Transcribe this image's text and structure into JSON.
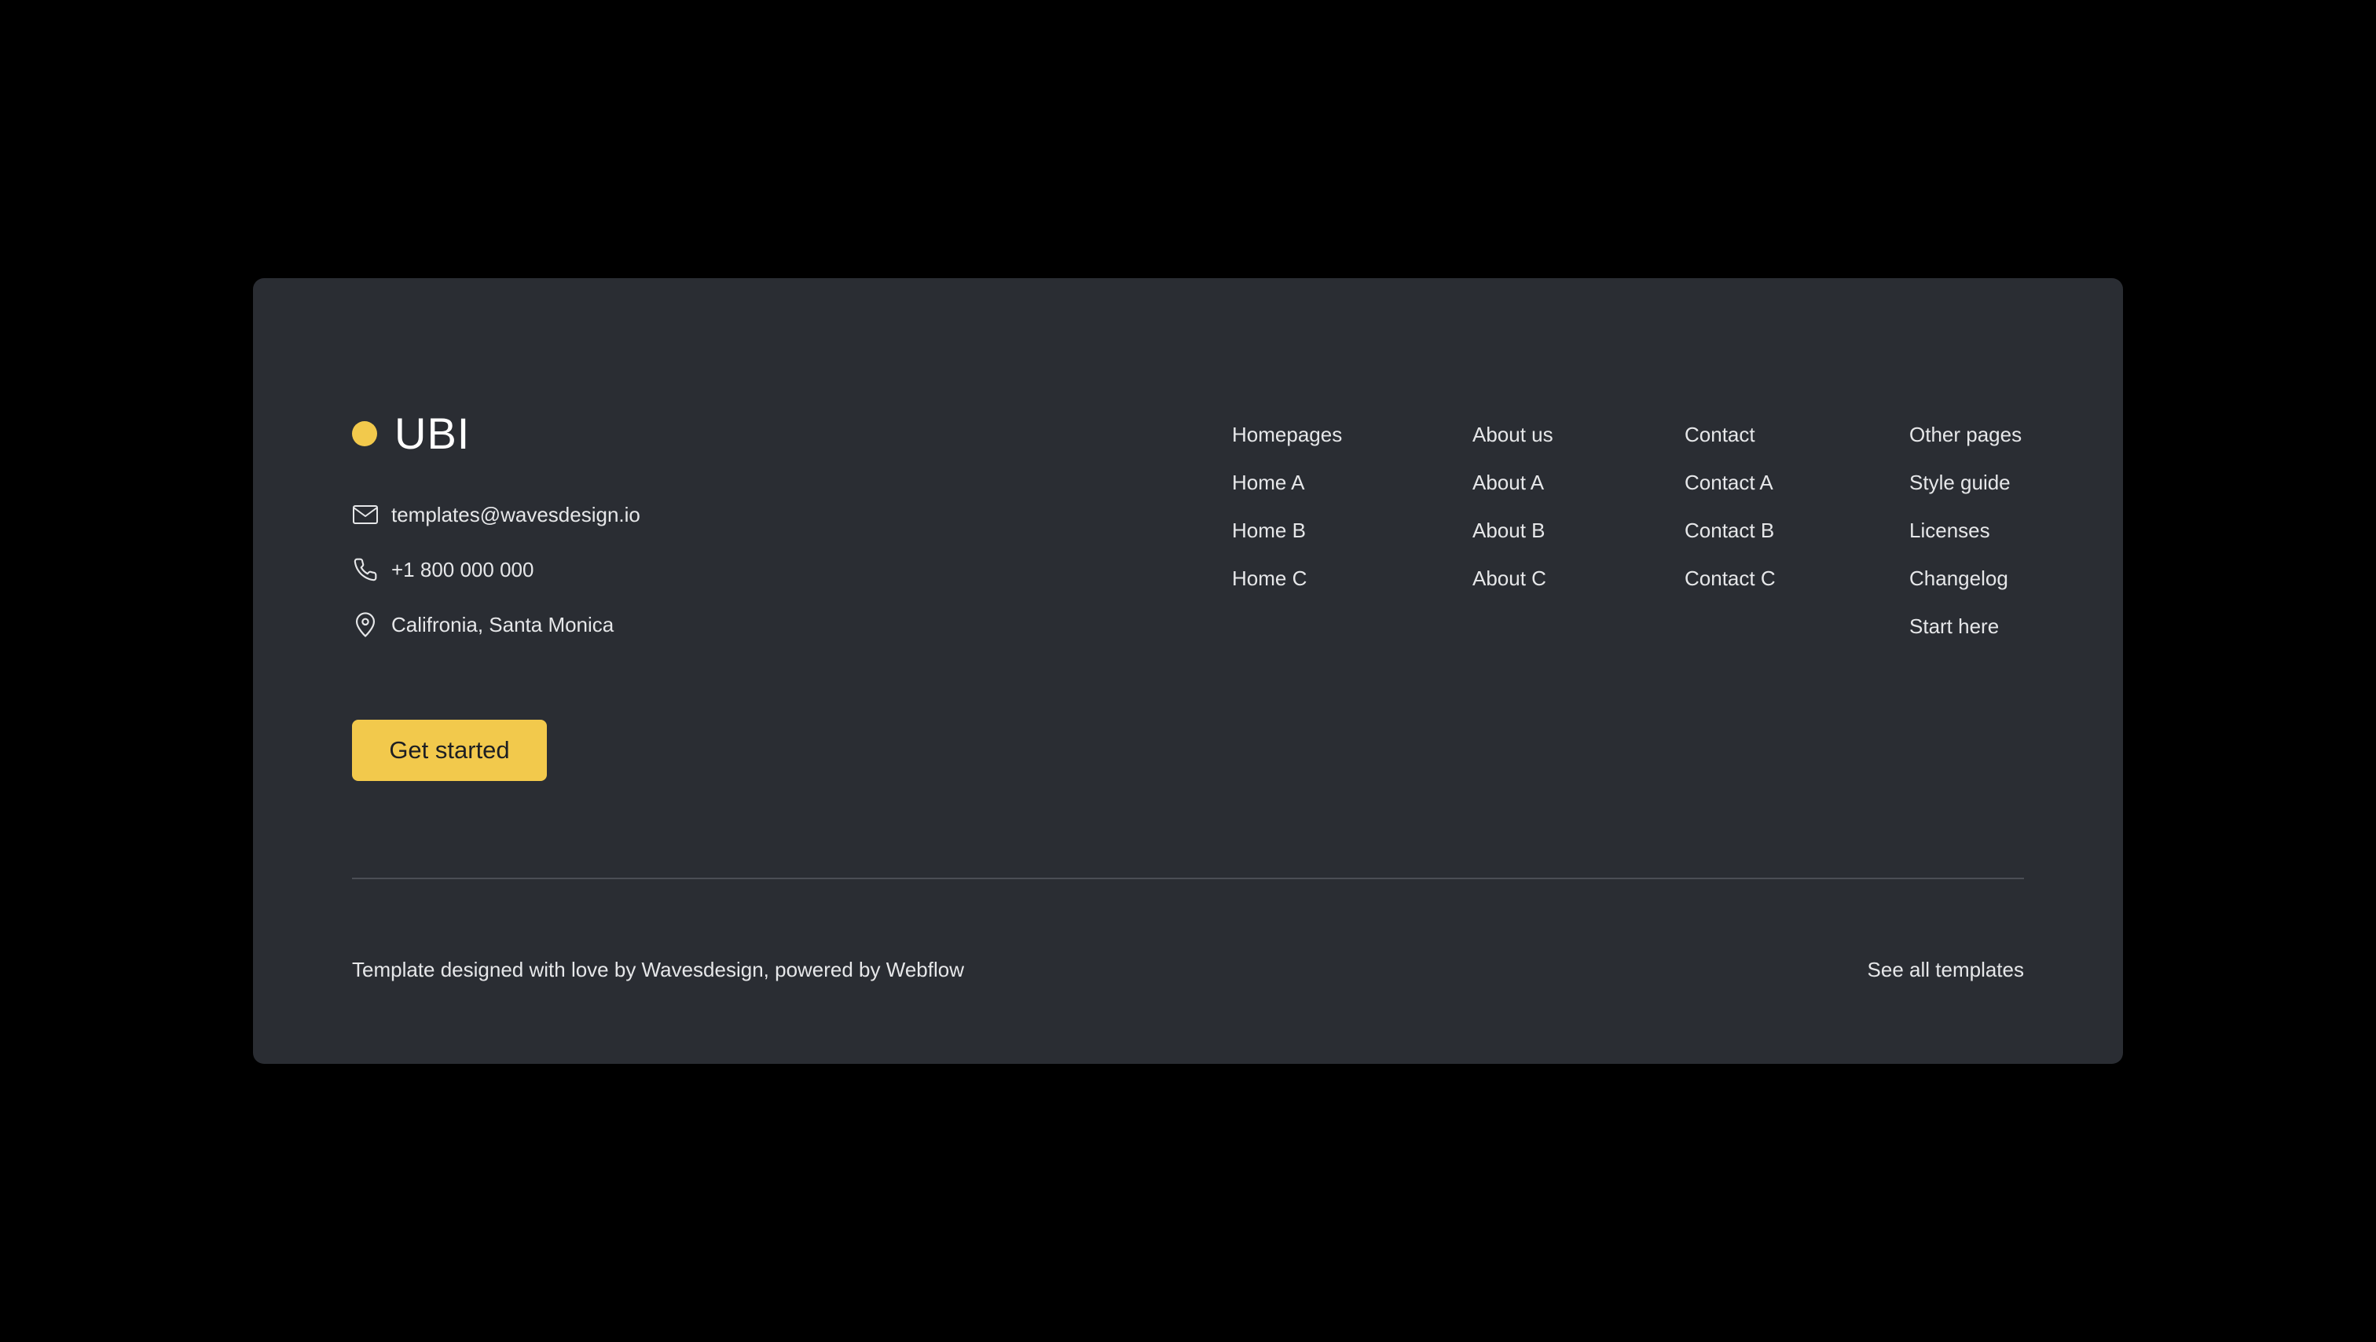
{
  "brand": {
    "name": "UBI",
    "dot_color": "#f2c94c"
  },
  "contact": {
    "email": "templates@wavesdesign.io",
    "phone": "+1 800 000 000",
    "address": "Califronia, Santa Monica",
    "icons": [
      "mail-icon",
      "phone-icon",
      "location-pin-icon"
    ]
  },
  "cta": {
    "label": "Get started",
    "color": "#f2c94c"
  },
  "nav": {
    "columns": [
      {
        "items": [
          "Homepages",
          "Home A",
          "Home B",
          "Home C"
        ]
      },
      {
        "items": [
          "About us",
          "About A",
          "About B",
          "About C"
        ]
      },
      {
        "items": [
          "Contact",
          "Contact A",
          "Contact B",
          "Contact C"
        ]
      },
      {
        "items": [
          "Other pages",
          "Style guide",
          "Licenses",
          "Changelog",
          "Start here"
        ]
      }
    ]
  },
  "bottom": {
    "credit": "Template designed with love by Wavesdesign, powered by Webflow",
    "see_all_label": "See all templates"
  },
  "colors": {
    "page_background": "#000000",
    "card_background": "#2a2d33",
    "accent": "#f2c94c",
    "text": "#e6e7e9",
    "divider": "#4b4e55"
  }
}
